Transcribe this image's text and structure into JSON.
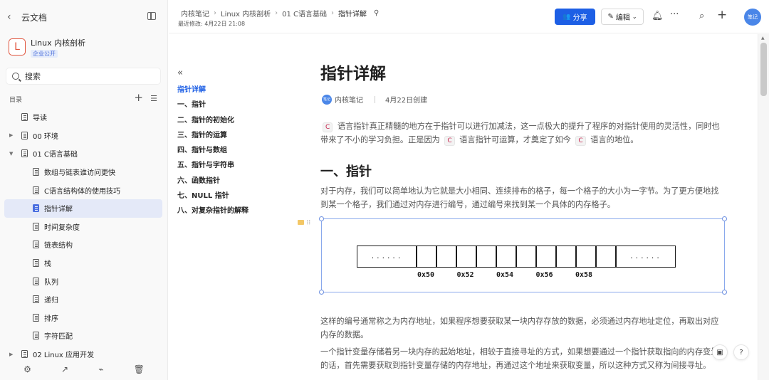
{
  "sidebar": {
    "back_label": "云文档",
    "repo": {
      "logo_letter": "L",
      "name": "Linux 内核剖析",
      "badge": "企业公开"
    },
    "search_placeholder": "搜索",
    "toc_label": "目录",
    "tree": [
      {
        "label": "导读",
        "level": 1,
        "caret": "",
        "active": false
      },
      {
        "label": "00 环境",
        "level": 1,
        "caret": "▶",
        "active": false
      },
      {
        "label": "01 C语言基础",
        "level": 1,
        "caret": "▼",
        "active": false
      },
      {
        "label": "数组与链表谁访问更快",
        "level": 2,
        "caret": "",
        "active": false
      },
      {
        "label": "C语言结构体的使用技巧",
        "level": 2,
        "caret": "",
        "active": false
      },
      {
        "label": "指针详解",
        "level": 2,
        "caret": "",
        "active": true
      },
      {
        "label": "时间复杂度",
        "level": 2,
        "caret": "",
        "active": false
      },
      {
        "label": "链表结构",
        "level": 2,
        "caret": "",
        "active": false
      },
      {
        "label": "栈",
        "level": 2,
        "caret": "",
        "active": false
      },
      {
        "label": "队列",
        "level": 2,
        "caret": "",
        "active": false
      },
      {
        "label": "递归",
        "level": 2,
        "caret": "",
        "active": false
      },
      {
        "label": "排序",
        "level": 2,
        "caret": "",
        "active": false
      },
      {
        "label": "字符匹配",
        "level": 2,
        "caret": "",
        "active": false
      },
      {
        "label": "02 Linux 应用开发",
        "level": 1,
        "caret": "▶",
        "active": false
      }
    ],
    "bottom_icons": [
      "settings-icon",
      "share-out-icon",
      "stats-icon",
      "trash-icon"
    ]
  },
  "header": {
    "breadcrumbs": [
      "内核笔记",
      "Linux 内核剖析",
      "01 C语言基础",
      "指针详解"
    ],
    "modified": "最近修改: 4月22日 21:08",
    "share_label": "分享",
    "edit_label": "编辑",
    "avatar_text": "笔记"
  },
  "outline": {
    "items": [
      "指针详解",
      "一、指针",
      "二、指针的初始化",
      "三、指针的运算",
      "四、指针与数组",
      "五、指针与字符串",
      "六、函数指针",
      "七、NULL 指针",
      "八、对复杂指针的解释"
    ],
    "active_index": 0
  },
  "doc": {
    "title": "指针详解",
    "author": "内核笔记",
    "author_avatar": "笔记",
    "created": "4月22日创建",
    "intro": [
      {
        "t": "code",
        "v": "C"
      },
      {
        "t": "text",
        "v": " 语言指针真正精髓的地方在于指针可以进行加减法，这一点极大的提升了程序的对指针使用的灵活性，同时也带来了不小的学习负担。正是因为 "
      },
      {
        "t": "code",
        "v": "C"
      },
      {
        "t": "text",
        "v": " 语言指针可运算，才奠定了如今 "
      },
      {
        "t": "code",
        "v": "C"
      },
      {
        "t": "text",
        "v": " 语言的地位。"
      }
    ],
    "h2": "一、指针",
    "para1": "对于内存，我们可以简单地认为它就是大小相同、连续排布的格子，每一个格子的大小为一字节。为了更方便地找到某一个格子，我们通过对内存进行编号，通过编号来找到某一个具体的内存格子。",
    "figure": {
      "ellipsis": "......",
      "cell_count": 10,
      "addresses": [
        "0x50",
        "0x52",
        "0x54",
        "0x56",
        "0x58"
      ]
    },
    "para2": "这样的编号通常称之为内存地址，如果程序想要获取某一块内存存放的数据，必须通过内存地址定位，再取出对应内存的数据。",
    "para3": "一个指针变量存储着另一块内存的起始地址，相较于直接寻址的方式，如果想要通过一个指针获取指向的内存变量的话，首先需要获取到指针变量存储的内存地址，再通过这个地址来获取变量，所以这种方式又称为间接寻址。"
  }
}
